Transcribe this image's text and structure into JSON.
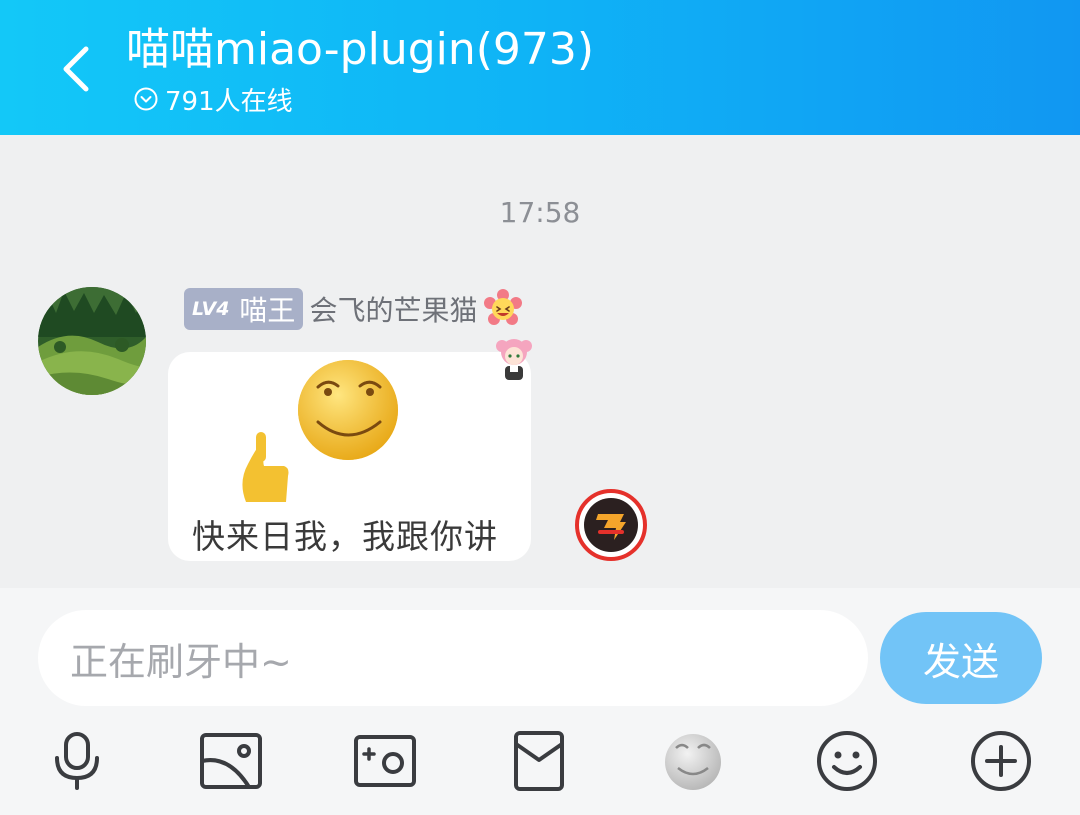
{
  "header": {
    "title": "喵喵miao-plugin(973)",
    "online": "791人在线"
  },
  "chat": {
    "time": "17:58",
    "message": {
      "level": "LV4",
      "rank": "喵王",
      "nickname": "会飞的芒果猫",
      "sticker_caption": "快来日我，我跟你讲"
    }
  },
  "input": {
    "placeholder": "正在刷牙中~",
    "send_label": "发送"
  },
  "toolbar": {
    "icons": [
      "microphone-icon",
      "image-icon",
      "camera-icon",
      "red-packet-icon",
      "emoji-sticker-icon",
      "smile-icon",
      "plus-icon"
    ]
  },
  "colors": {
    "header": "#13c8f8",
    "send_button": "#72c4f7",
    "badge": "#a8b0c8"
  }
}
